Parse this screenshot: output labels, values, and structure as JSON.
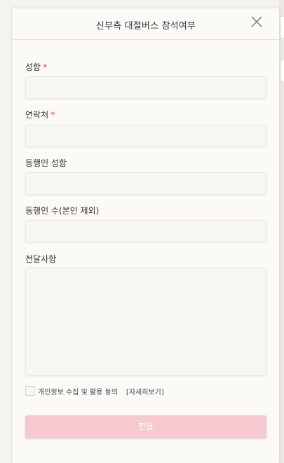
{
  "modal": {
    "title": "신부측 대절버스 참석여부",
    "close_icon": "close-icon"
  },
  "form": {
    "name": {
      "label": "성함",
      "required_mark": "*",
      "value": ""
    },
    "phone": {
      "label": "연락처",
      "required_mark": "*",
      "value": ""
    },
    "companion_name": {
      "label": "동행인 성함",
      "value": ""
    },
    "companion_count": {
      "label": "동행인 수(본인 제외)",
      "value": ""
    },
    "message": {
      "label": "전달사항",
      "value": ""
    },
    "consent": {
      "label": "개인정보 수집 및 활용 동의",
      "detail_link": "[자세히보기]",
      "checked": false
    },
    "submit_label": "전달"
  },
  "colors": {
    "submit_button": "#f5c9cf",
    "required_mark": "#e0424a"
  }
}
